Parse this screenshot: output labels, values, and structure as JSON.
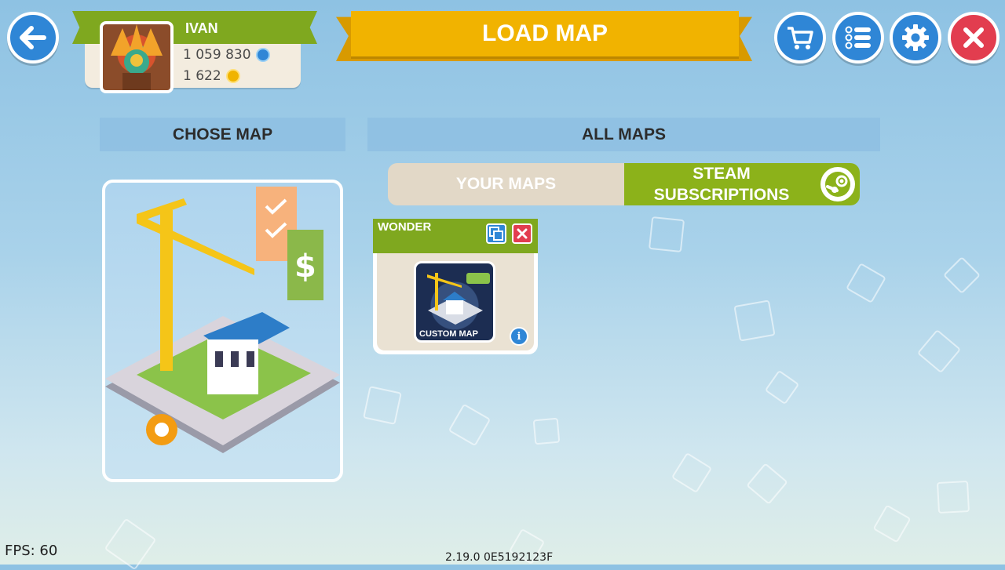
{
  "header": {
    "back_icon": "arrow-left-icon",
    "player": {
      "name": "IVAN",
      "currency_primary": "1 059 830",
      "currency_secondary": "1 622"
    },
    "title": "LOAD MAP",
    "actions": [
      {
        "icon": "cart-icon"
      },
      {
        "icon": "checklist-icon"
      },
      {
        "icon": "gear-icon"
      },
      {
        "icon": "close-icon"
      }
    ]
  },
  "left_panel": {
    "heading": "CHOSE MAP"
  },
  "right_panel": {
    "heading": "ALL MAPS",
    "tabs": {
      "your_maps": "YOUR MAPS",
      "steam": "STEAM SUBSCRIPTIONS",
      "steam_icon": "steam-icon"
    },
    "maps": [
      {
        "title": "WONDER",
        "thumbnail_label": "CUSTOM MAP"
      }
    ]
  },
  "footer": {
    "fps": "FPS: 60",
    "version": "2.19.0 0E5192123F"
  },
  "colors": {
    "green": "#7fa81f",
    "gold": "#f1b300",
    "blue": "#2f86d6",
    "red": "#e23d4f"
  }
}
